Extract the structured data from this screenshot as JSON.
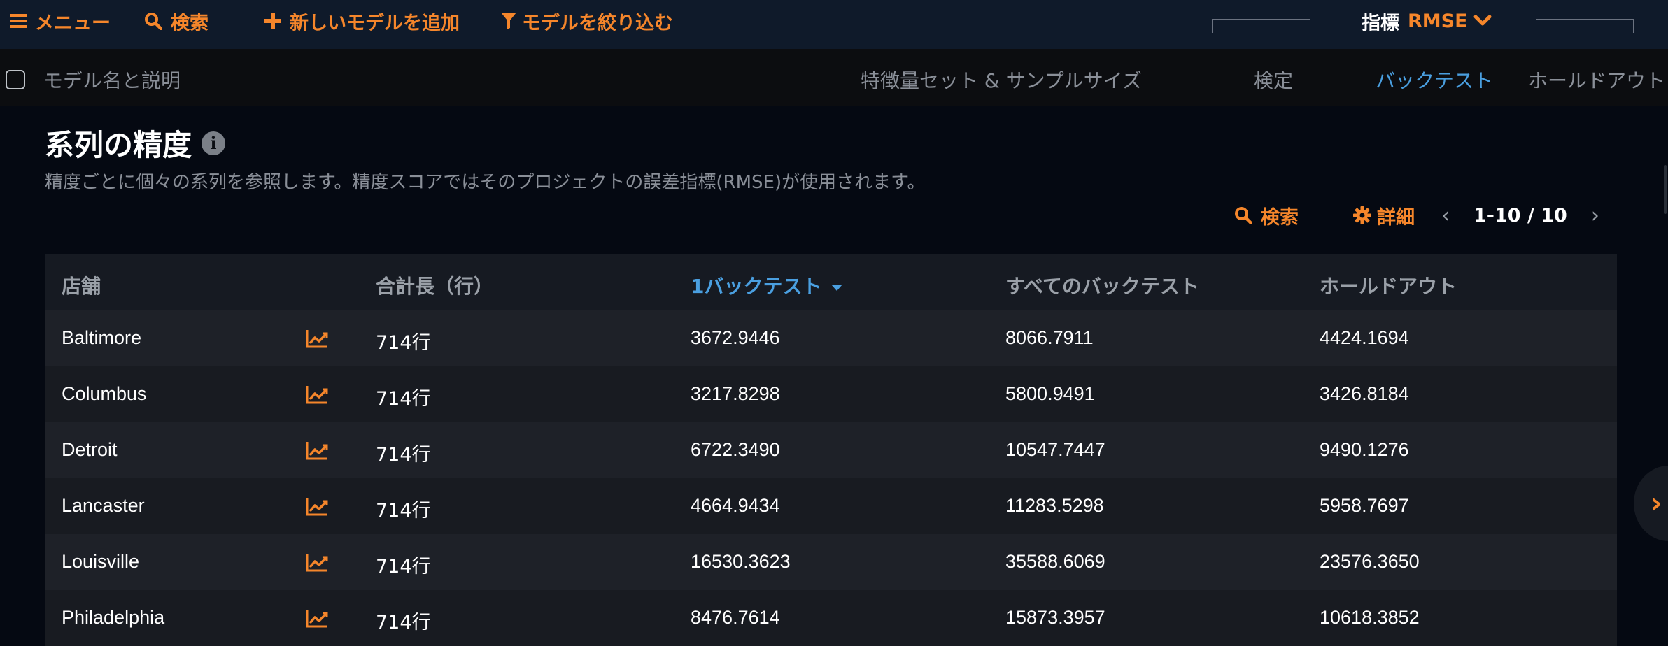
{
  "toolbar": {
    "menu": "メニュー",
    "search": "検索",
    "add_model": "新しいモデルを追加",
    "filter_models": "モデルを絞り込む",
    "metric_label": "指標",
    "metric_value": "RMSE"
  },
  "columns_bar": {
    "model_name": "モデル名と説明",
    "feature_sample": "特徴量セット & サンプルサイズ",
    "validation": "検定",
    "backtest": "バックテスト",
    "holdout": "ホールドアウト"
  },
  "section": {
    "title": "系列の精度",
    "description": "精度ごとに個々の系列を参照します。精度スコアではそのプロジェクトの誤差指標(RMSE)が使用されます。",
    "search": "検索",
    "details": "詳細",
    "pagination": "1-10 / 10"
  },
  "table": {
    "headers": {
      "store": "店舗",
      "total_length": "合計長（行）",
      "backtest1": "1バックテスト",
      "all_backtests": "すべてのバックテスト",
      "holdout": "ホールドアウト"
    },
    "rows": [
      {
        "store": "Baltimore",
        "length": "714行",
        "backtest1": "3672.9446",
        "all_backtests": "8066.7911",
        "holdout": "4424.1694"
      },
      {
        "store": "Columbus",
        "length": "714行",
        "backtest1": "3217.8298",
        "all_backtests": "5800.9491",
        "holdout": "3426.8184"
      },
      {
        "store": "Detroit",
        "length": "714行",
        "backtest1": "6722.3490",
        "all_backtests": "10547.7447",
        "holdout": "9490.1276"
      },
      {
        "store": "Lancaster",
        "length": "714行",
        "backtest1": "4664.9434",
        "all_backtests": "11283.5298",
        "holdout": "5958.7697"
      },
      {
        "store": "Louisville",
        "length": "714行",
        "backtest1": "16530.3623",
        "all_backtests": "35588.6069",
        "holdout": "23576.3650"
      },
      {
        "store": "Philadelphia",
        "length": "714行",
        "backtest1": "8476.7614",
        "all_backtests": "15873.3957",
        "holdout": "10618.3852"
      }
    ]
  },
  "colors": {
    "accent": "#f5862b",
    "link_blue": "#4a9fe0",
    "background": "#050912"
  },
  "icons": {
    "menu": "hamburger-icon",
    "search": "search-icon",
    "add": "plus-icon",
    "filter": "filter-icon",
    "metric_dropdown": "chevron-down-icon",
    "info": "info-icon",
    "details": "gear-icon",
    "row_chart": "line-chart-icon",
    "prev": "chevron-left-icon",
    "next": "chevron-right-icon"
  }
}
